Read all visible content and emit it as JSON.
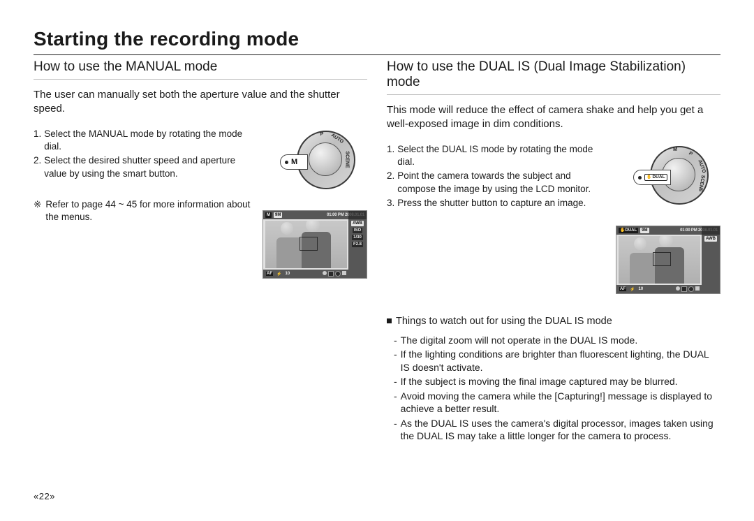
{
  "title": "Starting the recording mode",
  "left": {
    "heading": "How to use the MANUAL mode",
    "intro": "The user can manually set both the aperture value and the shutter speed.",
    "steps": [
      "Select the MANUAL mode by rotating the mode dial.",
      "Select the desired shutter speed and aperture value by using the smart button."
    ],
    "note_bullet": "※",
    "note": "Refer to page 44 ~ 45 for more information about the menus.",
    "dial_selected": "M",
    "dial_marks": {
      "top": "P",
      "top2": "AUTO",
      "right": "SCENE"
    },
    "lcd": {
      "mode_badge": "M",
      "top": {
        "quality": "9M",
        "timestamp": "01:00 PM 2008.01.01",
        "wb": "AWB"
      },
      "right": [
        "AWB",
        "ISO",
        "1/30",
        "F2.8"
      ],
      "bottom": {
        "af": "AF",
        "flash": "⚡",
        "count": "10"
      }
    }
  },
  "right": {
    "heading": "How to use the DUAL IS (Dual Image Stabilization) mode",
    "intro": "This mode will reduce the effect of camera shake and help you get a well-exposed image in dim conditions.",
    "steps": [
      "Select the DUAL IS mode by rotating the mode dial.",
      "Point the camera towards the subject and compose the image by using the LCD monitor.",
      "Press the shutter button to capture an image."
    ],
    "dial_selected": "DUAL",
    "dial_marks": {
      "top": "M",
      "top2": "P",
      "right": "AUTO",
      "right2": "SCENE"
    },
    "lcd": {
      "mode_badge": "DUAL",
      "top": {
        "quality": "9M",
        "timestamp": "01:00 PM 2008.01.01",
        "wb": "AWB"
      },
      "right": [
        "AWB"
      ],
      "bottom": {
        "af": "AF",
        "flash": "⚡",
        "count": "10"
      }
    },
    "watch_heading": "Things to watch out for using the DUAL IS mode",
    "watch_items": [
      "The digital zoom will not operate in the DUAL IS mode.",
      "If the lighting conditions are brighter than fluorescent lighting, the DUAL IS doesn't activate.",
      "If the subject is moving the final image captured may be blurred.",
      "Avoid moving the camera while the [Capturing!] message is displayed to achieve a better result.",
      "As the DUAL IS uses the camera's digital processor, images taken using the DUAL IS may take a little longer for the camera to process."
    ]
  },
  "page_number": "22"
}
